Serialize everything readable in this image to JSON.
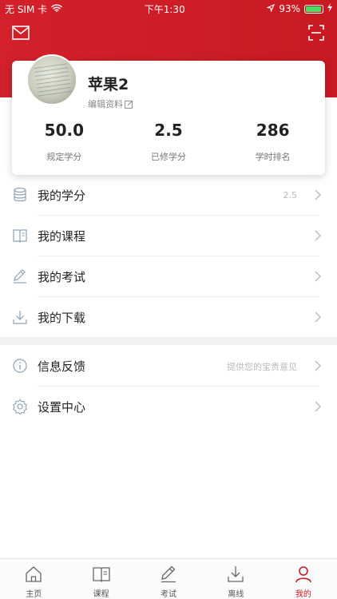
{
  "status_bar": {
    "carrier": "无 SIM 卡",
    "time": "下午1:30",
    "battery": "93%",
    "battery_level": 0.93
  },
  "colors": {
    "brand": "#c81a22",
    "battery_green": "#4cd964"
  },
  "header": {
    "left_icon": "mail-icon",
    "right_icon": "scan-icon"
  },
  "profile": {
    "name": "苹果2",
    "edit_label": "编辑资料",
    "stats": [
      {
        "value": "50.0",
        "label": "规定学分"
      },
      {
        "value": "2.5",
        "label": "已修学分"
      },
      {
        "value": "286",
        "label": "学时排名"
      }
    ]
  },
  "menu": [
    {
      "label": "我的学分",
      "value": "2.5",
      "icon": "database-icon"
    },
    {
      "label": "我的课程",
      "value": "",
      "icon": "book-icon"
    },
    {
      "label": "我的考试",
      "value": "",
      "icon": "pen-icon"
    },
    {
      "label": "我的下载",
      "value": "",
      "icon": "download-icon"
    }
  ],
  "menu2": [
    {
      "label": "信息反馈",
      "value": "提供您的宝贵意见",
      "icon": "info-icon"
    },
    {
      "label": "设置中心",
      "value": "",
      "icon": "settings-icon"
    }
  ],
  "tabs": [
    {
      "label": "主页",
      "icon": "home-icon"
    },
    {
      "label": "课程",
      "icon": "book-icon"
    },
    {
      "label": "考试",
      "icon": "pen-icon"
    },
    {
      "label": "离线",
      "icon": "download-icon"
    },
    {
      "label": "我的",
      "icon": "person-icon",
      "active": true
    }
  ]
}
